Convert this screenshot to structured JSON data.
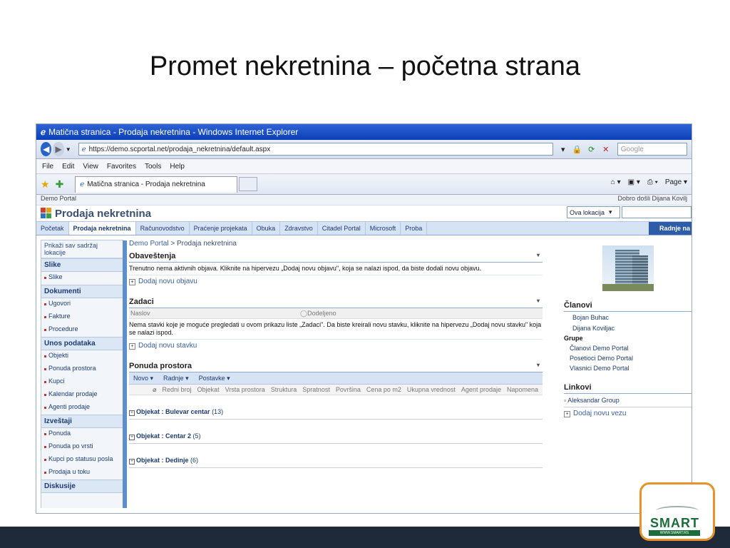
{
  "slide": {
    "title": "Promet nekretnina – početna strana"
  },
  "browser": {
    "window_title": "Matična stranica - Prodaja nekretnina - Windows Internet Explorer",
    "url": "https://demo.scportal.net/prodaja_nekretnina/default.aspx",
    "search_placeholder": "Google",
    "menu": [
      "File",
      "Edit",
      "View",
      "Favorites",
      "Tools",
      "Help"
    ],
    "tab_label": "Matična stranica - Prodaja nekretnina",
    "page_cmd": "Page"
  },
  "portal": {
    "top_left": "Demo Portal",
    "welcome": "Dobro došli Dijana Kovilj",
    "site_title": "Prodaja nekretnina",
    "scope": "Ova lokacija",
    "nav": [
      "Početak",
      "Prodaja nekretnina",
      "Računovodstvo",
      "Praćenje projekata",
      "Obuka",
      "Zdravstvo",
      "Citadel Portal",
      "Microsoft",
      "Proba"
    ],
    "actions": "Radnje na"
  },
  "quicklaunch": {
    "view_all": "Prikaži sav sadržaj lokacije",
    "sections": [
      {
        "title": "Slike",
        "items": [
          "Slike"
        ]
      },
      {
        "title": "Dokumenti",
        "items": [
          "Ugovori",
          "Fakture",
          "Procedure"
        ]
      },
      {
        "title": "Unos podataka",
        "items": [
          "Objekti",
          "Ponuda prostora",
          "Kupci",
          "Kalendar prodaje",
          "Agenti prodaje"
        ]
      },
      {
        "title": "Izveštaji",
        "items": [
          "Ponuda",
          "Ponuda po vrsti",
          "Kupci po statusu posla",
          "Prodaja u toku"
        ]
      },
      {
        "title": "Diskusije",
        "items": []
      }
    ]
  },
  "main": {
    "breadcrumb_root": "Demo Portal",
    "breadcrumb_sep": ">",
    "breadcrumb_current": "Prodaja nekretnina",
    "announcements": {
      "title": "Obaveštenja",
      "empty_text": "Trenutno nema aktivnih objava. Kliknite na hipervezu „Dodaj novu objavu\", koja se nalazi ispod, da biste dodali novu objavu.",
      "add": "Dodaj novu objavu"
    },
    "tasks": {
      "title": "Zadaci",
      "col_title": "Naslov",
      "col_assigned": "Dodeljeno",
      "empty_text": "Nema stavki koje je moguće pregledati u ovom prikazu liste „Zadaci\". Da biste kreirali novu stavku, kliknite na hipervezu „Dodaj novu stavku\" koja se nalazi ispod.",
      "add": "Dodaj novu stavku"
    },
    "offer": {
      "title": "Ponuda prostora",
      "toolbar": [
        "Novo",
        "Radnje",
        "Postavke"
      ],
      "columns": [
        "Redni broj",
        "Objekat",
        "Vrsta prostora",
        "Struktura",
        "Spratnost",
        "Površina",
        "Cena po m2",
        "Ukupna vrednost",
        "Agent prodaje",
        "Napomena"
      ],
      "groups": [
        {
          "label": "Objekat : Bulevar centar",
          "count": "(13)"
        },
        {
          "label": "Objekat : Centar 2",
          "count": "(5)"
        },
        {
          "label": "Objekat : Dedinje",
          "count": "(6)"
        }
      ]
    }
  },
  "right": {
    "members_title": "Članovi",
    "members": [
      "Bojan Buhac",
      "Dijana Koviljac"
    ],
    "groups_title": "Grupe",
    "groups": [
      "Članovi Demo Portal",
      "Posetioci Demo Portal",
      "Vlasnici Demo Portal"
    ],
    "links_title": "Linkovi",
    "links": [
      "Aleksandar Group"
    ],
    "add_link": "Dodaj novu vezu"
  },
  "logo": {
    "text": "SMART",
    "url": "WWW.SMART.RS"
  }
}
